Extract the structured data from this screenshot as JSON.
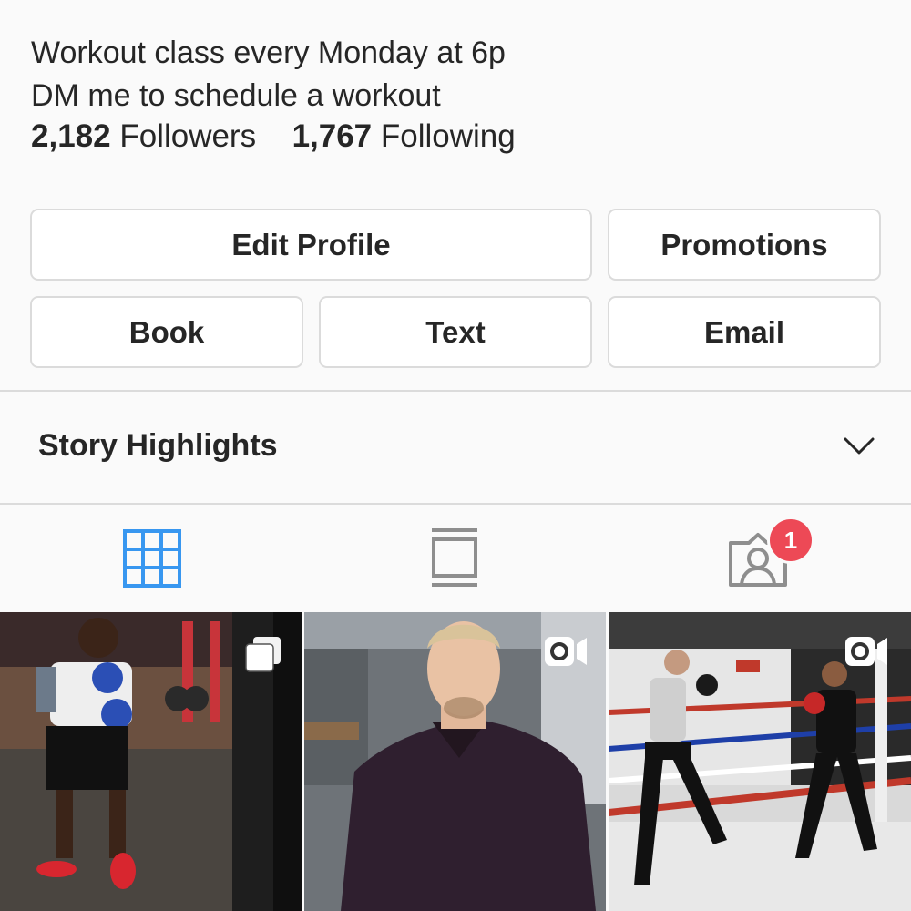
{
  "bio": {
    "line1": "Workout class every Monday at 6p",
    "line2": "DM me to schedule a workout"
  },
  "stats": {
    "followers_count": "2,182",
    "followers_label": "Followers",
    "following_count": "1,767",
    "following_label": "Following"
  },
  "buttons": {
    "edit_profile": "Edit Profile",
    "promotions": "Promotions",
    "book": "Book",
    "text": "Text",
    "email": "Email"
  },
  "highlights": {
    "title": "Story Highlights"
  },
  "tabs": {
    "grid_icon": "grid-icon",
    "feed_icon": "feed-icon",
    "tagged_icon": "tagged-person-icon",
    "tagged_badge": "1",
    "active_color": "#3897f0",
    "inactive_color": "#8e8e8e"
  },
  "posts": [
    {
      "type": "carousel",
      "icon": "multiple-photos-icon"
    },
    {
      "type": "video",
      "icon": "video-camera-icon"
    },
    {
      "type": "video",
      "icon": "video-camera-icon"
    }
  ]
}
